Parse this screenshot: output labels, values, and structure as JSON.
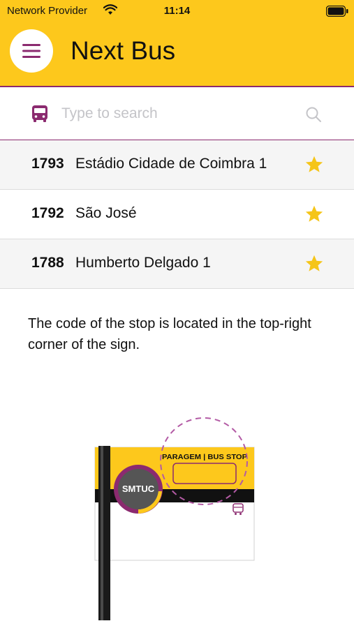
{
  "status_bar": {
    "carrier": "Network Provider",
    "time": "11:14"
  },
  "header": {
    "title": "Next Bus",
    "menu_icon": "hamburger-menu-icon"
  },
  "search": {
    "placeholder": "Type to search",
    "value": "",
    "leading_icon": "bus-icon",
    "trailing_icon": "search-icon"
  },
  "stops": [
    {
      "code": "1793",
      "name": "Estádio Cidade de Coimbra 1",
      "favorite": true
    },
    {
      "code": "1792",
      "name": "São José",
      "favorite": true
    },
    {
      "code": "1788",
      "name": "Humberto Delgado 1",
      "favorite": true
    }
  ],
  "help": {
    "text": "The code of the stop is located in the top-right corner of the sign."
  },
  "sign": {
    "logo_text": "SMTUC",
    "header_text": "PARAGEM | BUS STOP"
  },
  "colors": {
    "brand_yellow": "#fdc81c",
    "brand_purple": "#8b2a6f",
    "star": "#f5c518",
    "row_alt": "#f5f5f5"
  }
}
